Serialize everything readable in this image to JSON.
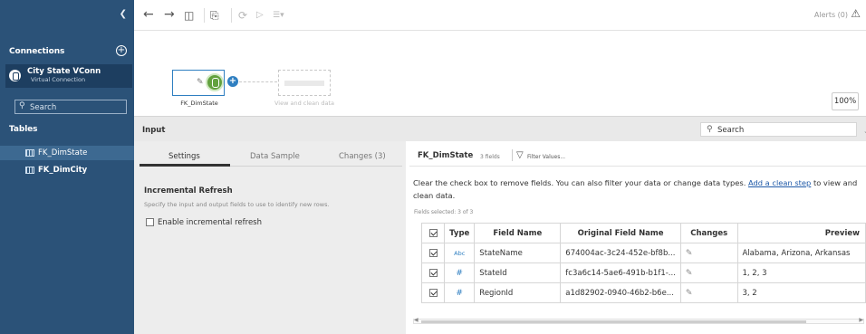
{
  "sidebar": {
    "connections_title": "Connections",
    "connection": {
      "name": "City State VConn",
      "subtitle": "Virtual Connection"
    },
    "search_placeholder": "Search",
    "tables_title": "Tables",
    "tables": [
      {
        "label": "FK_DimState",
        "selected": true
      },
      {
        "label": "FK_DimCity",
        "selected": false
      }
    ]
  },
  "toolbar": {
    "alerts_label": "Alerts (0)"
  },
  "canvas": {
    "node_label": "FK_DimState",
    "ghost_label": "View and clean data",
    "zoom": "100%"
  },
  "input_bar": {
    "title": "Input",
    "search_placeholder": "Search"
  },
  "left_panel": {
    "tabs": [
      "Settings",
      "Data Sample",
      "Changes (3)"
    ],
    "active_tab": "Settings",
    "incremental": {
      "title": "Incremental Refresh",
      "subtitle": "Specify the input and output fields to use to identify new rows.",
      "checkbox_label": "Enable incremental refresh",
      "checked": false
    }
  },
  "right_panel": {
    "table_name": "FK_DimState",
    "field_count": "3 fields",
    "filter_label": "Filter Values...",
    "desc_pre": "Clear the check box to remove fields. You can also filter your data or change data types. ",
    "desc_link": "Add a clean step",
    "desc_post": " to view and clean data.",
    "fields_selected": "Fields selected: 3 of 3",
    "columns": [
      "Type",
      "Field Name",
      "Original Field Name",
      "Changes",
      "Preview"
    ],
    "rows": [
      {
        "type": "Abc",
        "field": "StateName",
        "original": "674004ac-3c24-452e-bf8b...",
        "preview": "Alabama, Arizona, Arkansas"
      },
      {
        "type": "#",
        "field": "StateId",
        "original": "fc3a6c14-5ae6-491b-b1f1-...",
        "preview": "1, 2, 3"
      },
      {
        "type": "#",
        "field": "RegionId",
        "original": "a1d82902-0940-46b2-b6e...",
        "preview": "3, 2"
      }
    ]
  }
}
